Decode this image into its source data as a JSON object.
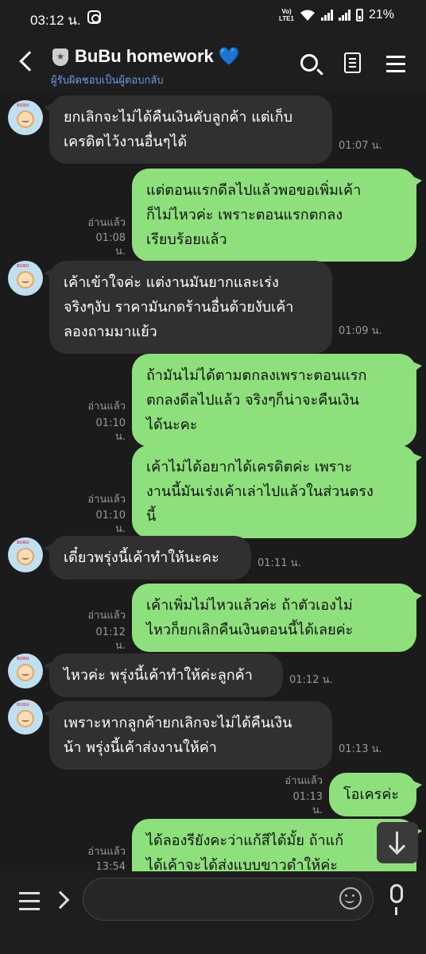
{
  "status_bar": {
    "time": "03:12 น.",
    "network_label": "VoLTE1",
    "battery_percent": "21%"
  },
  "header": {
    "title": "BuBu homework 💙",
    "subtitle": "ผู้รับผิดชอบเป็นผู้ตอบกลับ"
  },
  "messages": [
    {
      "side": "in",
      "lines": [
        "ยกเลิกจะไม่ได้คืนเงินคับลูกค้า แต่เก็บ",
        "เครดิตไว้งานอื่นๆได้"
      ],
      "time": "01:07 น."
    },
    {
      "side": "out",
      "lines": [
        "แต่ตอนแรกดีลไปแล้วพอขอเพิ่มเค้า",
        "ก็ไม่ไหวค่ะ  เพราะตอนแรกตกลง",
        "เรียบร้อยแล้ว"
      ],
      "read": "อ่านแล้ว",
      "time": "01:08 น."
    },
    {
      "side": "in",
      "lines": [
        "เค้าเข้าใจค่ะ แต่งานมันยากและเร่ง",
        "จริงๆงับ ราคามันกดร้านอื่นด้วยงับเค้า",
        "ลองถามมาแย้ว"
      ],
      "time": "01:09 น."
    },
    {
      "side": "out",
      "lines": [
        "ถ้ามันไม่ได้ตามตกลงเพราะตอนแรก",
        "ตกลงดีลไปแล้ว  จริงๆก็น่าจะคืนเงิน",
        "ได้นะคะ"
      ],
      "read": "อ่านแล้ว",
      "time": "01:10 น."
    },
    {
      "side": "out",
      "lines": [
        "เค้าไม่ได้อยากได้เครดิตค่ะ  เพราะ",
        "งานนี้มันเร่งเค้าเล่าไปแล้วในส่วนตรง",
        "นี้"
      ],
      "read": "อ่านแล้ว",
      "time": "01:10 น."
    },
    {
      "side": "in",
      "lines": [
        "เดี๋ยวพรุ่งนี้เค้าทำให้นะคะ"
      ],
      "time": "01:11 น."
    },
    {
      "side": "out",
      "lines": [
        "เค้าเพิ่มไม่ไหวแล้วค่ะ  ถ้าตัวเองไม่",
        "ไหวก็ยกเลิกคืนเงินตอนนี้ได้เลยค่ะ"
      ],
      "read": "อ่านแล้ว",
      "time": "01:12 น."
    },
    {
      "side": "in",
      "lines": [
        "ไหวค่ะ พรุ่งนี้เค้าทำให้ค่ะลูกค้า"
      ],
      "time": "01:12 น."
    },
    {
      "side": "in",
      "lines": [
        "เพราะหากลูกค้ายกเลิกจะไม่ได้คืนเงิน",
        "น้า พรุ่งนี้เค้าส่งงานให้ค่า"
      ],
      "time": "01:13 น."
    },
    {
      "side": "out",
      "lines": [
        "โอเครค่ะ"
      ],
      "read": "อ่านแล้ว",
      "time": "01:13 น."
    },
    {
      "side": "out",
      "lines": [
        "ได้ลองรียังคะว่าแก้สีได้มั้ย  ถ้าแก้",
        "ได้เค้าจะได้ส่งแบบขาวดำให้ค่ะ"
      ],
      "read": "อ่านแล้ว",
      "time": "13:54 น."
    }
  ],
  "avatar_tag": "BUBU",
  "input": {
    "placeholder": ""
  },
  "colors": {
    "outgoing_bubble": "#8ee07c",
    "incoming_bubble": "#303030",
    "background": "#1b1b1b",
    "subtitle": "#6f9be9"
  },
  "icons": [
    "back-icon",
    "shield-icon",
    "search-icon",
    "note-icon",
    "menu-icon",
    "scroll-down-icon",
    "menu-lines-icon",
    "chevron-right-icon",
    "emoji-icon",
    "mic-icon",
    "instagram-icon",
    "wifi-icon",
    "signal-icon",
    "battery-icon"
  ]
}
